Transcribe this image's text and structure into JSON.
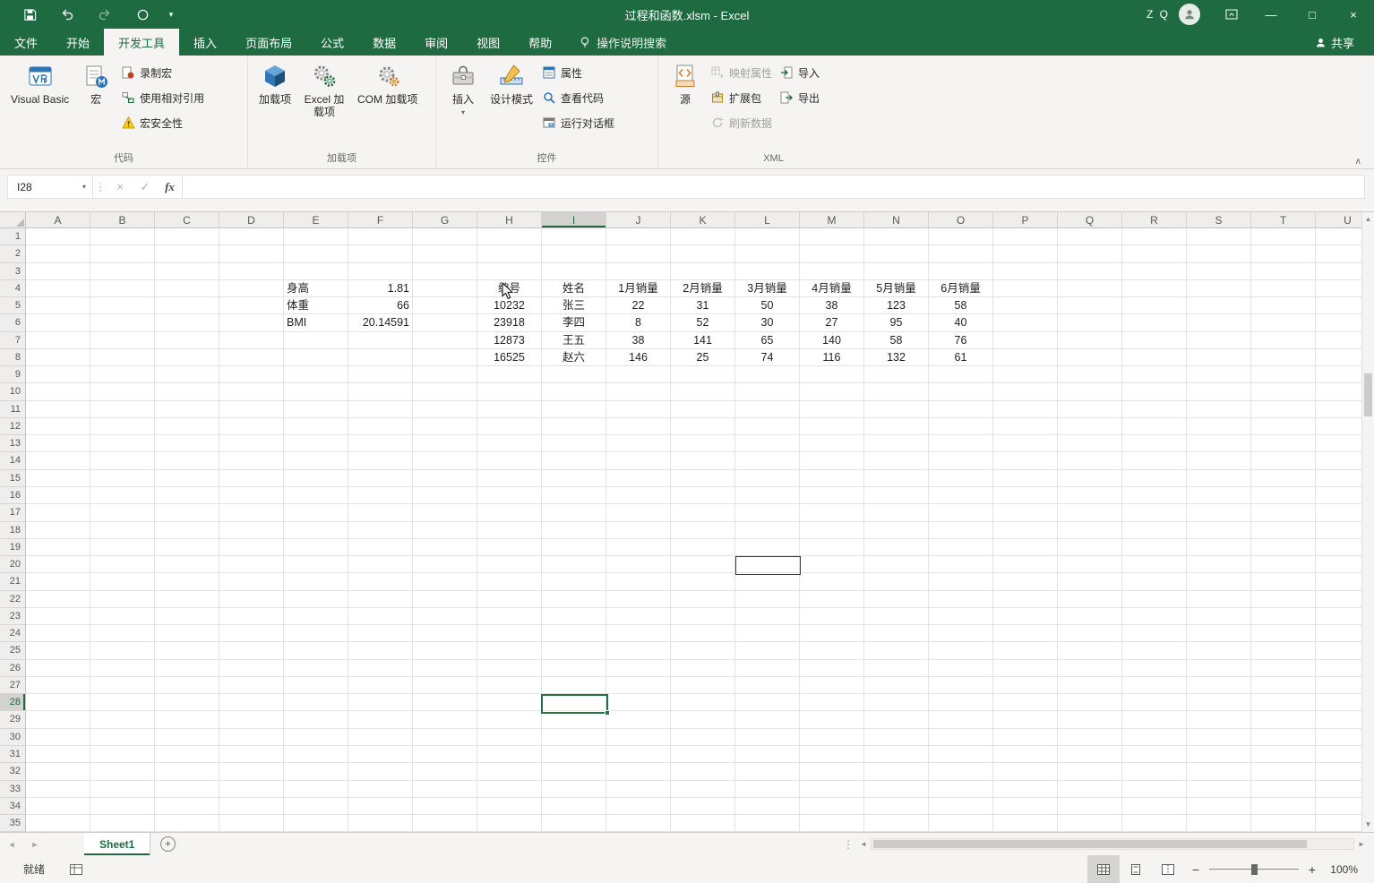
{
  "titlebar": {
    "title": "过程和函数.xlsm - Excel",
    "user_initials": "Z Q"
  },
  "ribbon": {
    "tabs": [
      {
        "label": "文件",
        "name": "file",
        "active": false
      },
      {
        "label": "开始",
        "name": "home",
        "active": false
      },
      {
        "label": "开发工具",
        "name": "developer",
        "active": true
      },
      {
        "label": "插入",
        "name": "insert",
        "active": false
      },
      {
        "label": "页面布局",
        "name": "page-layout",
        "active": false
      },
      {
        "label": "公式",
        "name": "formulas",
        "active": false
      },
      {
        "label": "数据",
        "name": "data",
        "active": false
      },
      {
        "label": "审阅",
        "name": "review",
        "active": false
      },
      {
        "label": "视图",
        "name": "view",
        "active": false
      },
      {
        "label": "帮助",
        "name": "help",
        "active": false
      }
    ],
    "search_label": "操作说明搜索",
    "share_label": "共享",
    "groups": {
      "code": {
        "label": "代码",
        "visual_basic": "Visual Basic",
        "macros": "宏",
        "record_macro": "录制宏",
        "use_relative_references": "使用相对引用",
        "macro_security": "宏安全性"
      },
      "addins": {
        "label": "加载项",
        "addins": "加载项",
        "excel_addins": "Excel 加载项",
        "com_addins": "COM 加载项"
      },
      "controls": {
        "label": "控件",
        "insert": "插入",
        "design_mode": "设计模式",
        "properties": "属性",
        "view_code": "查看代码",
        "run_dialog": "运行对话框"
      },
      "xml": {
        "label": "XML",
        "source": "源",
        "map_properties": "映射属性",
        "expansion_packs": "扩展包",
        "refresh_data": "刷新数据",
        "import": "导入",
        "export": "导出"
      }
    }
  },
  "formula_bar": {
    "name_box": "I28",
    "formula_value": ""
  },
  "sheet": {
    "columns": [
      "A",
      "B",
      "C",
      "D",
      "E",
      "F",
      "G",
      "H",
      "I",
      "J",
      "K",
      "L",
      "M",
      "N",
      "O",
      "P",
      "Q",
      "R",
      "S",
      "T",
      "U"
    ],
    "row_count": 35,
    "selection": {
      "cell": "I28",
      "col": "I",
      "row": 28
    },
    "bordered_empty_cell": {
      "col": "L",
      "row": 20
    },
    "cells": [
      {
        "c": "E",
        "r": 4,
        "v": "身高",
        "a": "l"
      },
      {
        "c": "F",
        "r": 4,
        "v": "1.81",
        "a": "r"
      },
      {
        "c": "E",
        "r": 5,
        "v": "体重",
        "a": "l"
      },
      {
        "c": "F",
        "r": 5,
        "v": "66",
        "a": "r"
      },
      {
        "c": "E",
        "r": 6,
        "v": "BMI",
        "a": "l"
      },
      {
        "c": "F",
        "r": 6,
        "v": "20.14591",
        "a": "r"
      },
      {
        "c": "H",
        "r": 4,
        "v": "编号",
        "a": "c"
      },
      {
        "c": "I",
        "r": 4,
        "v": "姓名",
        "a": "c"
      },
      {
        "c": "J",
        "r": 4,
        "v": "1月销量",
        "a": "c"
      },
      {
        "c": "K",
        "r": 4,
        "v": "2月销量",
        "a": "c"
      },
      {
        "c": "L",
        "r": 4,
        "v": "3月销量",
        "a": "c"
      },
      {
        "c": "M",
        "r": 4,
        "v": "4月销量",
        "a": "c"
      },
      {
        "c": "N",
        "r": 4,
        "v": "5月销量",
        "a": "c"
      },
      {
        "c": "O",
        "r": 4,
        "v": "6月销量",
        "a": "c"
      },
      {
        "c": "H",
        "r": 5,
        "v": "10232",
        "a": "c"
      },
      {
        "c": "I",
        "r": 5,
        "v": "张三",
        "a": "c"
      },
      {
        "c": "J",
        "r": 5,
        "v": "22",
        "a": "c"
      },
      {
        "c": "K",
        "r": 5,
        "v": "31",
        "a": "c"
      },
      {
        "c": "L",
        "r": 5,
        "v": "50",
        "a": "c"
      },
      {
        "c": "M",
        "r": 5,
        "v": "38",
        "a": "c"
      },
      {
        "c": "N",
        "r": 5,
        "v": "123",
        "a": "c"
      },
      {
        "c": "O",
        "r": 5,
        "v": "58",
        "a": "c"
      },
      {
        "c": "H",
        "r": 6,
        "v": "23918",
        "a": "c"
      },
      {
        "c": "I",
        "r": 6,
        "v": "李四",
        "a": "c"
      },
      {
        "c": "J",
        "r": 6,
        "v": "8",
        "a": "c"
      },
      {
        "c": "K",
        "r": 6,
        "v": "52",
        "a": "c"
      },
      {
        "c": "L",
        "r": 6,
        "v": "30",
        "a": "c"
      },
      {
        "c": "M",
        "r": 6,
        "v": "27",
        "a": "c"
      },
      {
        "c": "N",
        "r": 6,
        "v": "95",
        "a": "c"
      },
      {
        "c": "O",
        "r": 6,
        "v": "40",
        "a": "c"
      },
      {
        "c": "H",
        "r": 7,
        "v": "12873",
        "a": "c"
      },
      {
        "c": "I",
        "r": 7,
        "v": "王五",
        "a": "c"
      },
      {
        "c": "J",
        "r": 7,
        "v": "38",
        "a": "c"
      },
      {
        "c": "K",
        "r": 7,
        "v": "141",
        "a": "c"
      },
      {
        "c": "L",
        "r": 7,
        "v": "65",
        "a": "c"
      },
      {
        "c": "M",
        "r": 7,
        "v": "140",
        "a": "c"
      },
      {
        "c": "N",
        "r": 7,
        "v": "58",
        "a": "c"
      },
      {
        "c": "O",
        "r": 7,
        "v": "76",
        "a": "c"
      },
      {
        "c": "H",
        "r": 8,
        "v": "16525",
        "a": "c"
      },
      {
        "c": "I",
        "r": 8,
        "v": "赵六",
        "a": "c"
      },
      {
        "c": "J",
        "r": 8,
        "v": "146",
        "a": "c"
      },
      {
        "c": "K",
        "r": 8,
        "v": "25",
        "a": "c"
      },
      {
        "c": "L",
        "r": 8,
        "v": "74",
        "a": "c"
      },
      {
        "c": "M",
        "r": 8,
        "v": "116",
        "a": "c"
      },
      {
        "c": "N",
        "r": 8,
        "v": "132",
        "a": "c"
      },
      {
        "c": "O",
        "r": 8,
        "v": "61",
        "a": "c"
      }
    ]
  },
  "sheet_tabs": {
    "tabs": [
      {
        "label": "Sheet1",
        "name": "sheet1",
        "active": true
      }
    ]
  },
  "status_bar": {
    "status": "就绪",
    "zoom": "100%"
  },
  "colors": {
    "titlebar_green": "#1e6b41",
    "accent_green": "#217346"
  }
}
